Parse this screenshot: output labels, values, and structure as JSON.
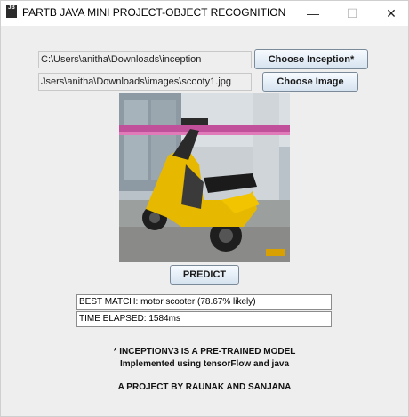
{
  "window": {
    "title": "PARTB JAVA MINI PROJECT-OBJECT RECOGNITION",
    "app_icon_text": "JB",
    "minimize_glyph": "—",
    "maximize_glyph": "☐",
    "close_glyph": "✕"
  },
  "form": {
    "inception_path": "C:\\Users\\anitha\\Downloads\\inception",
    "image_path": "Jsers\\anitha\\Downloads\\images\\scooty1.jpg",
    "choose_inception_label": "Choose Inception*",
    "choose_image_label": "Choose Image",
    "predict_label": "PREDICT"
  },
  "results": {
    "best_match": "BEST MATCH: motor scooter (78.67% likely)",
    "time_elapsed": "TIME ELAPSED: 1584ms"
  },
  "footer": {
    "line1": "* INCEPTIONV3 IS A PRE-TRAINED MODEL",
    "line2": "Implemented using tensorFlow and java",
    "line3": "A PROJECT BY RAUNAK AND SANJANA"
  },
  "icons": {
    "app": "java-app-icon",
    "photo": "scooter-photo"
  }
}
